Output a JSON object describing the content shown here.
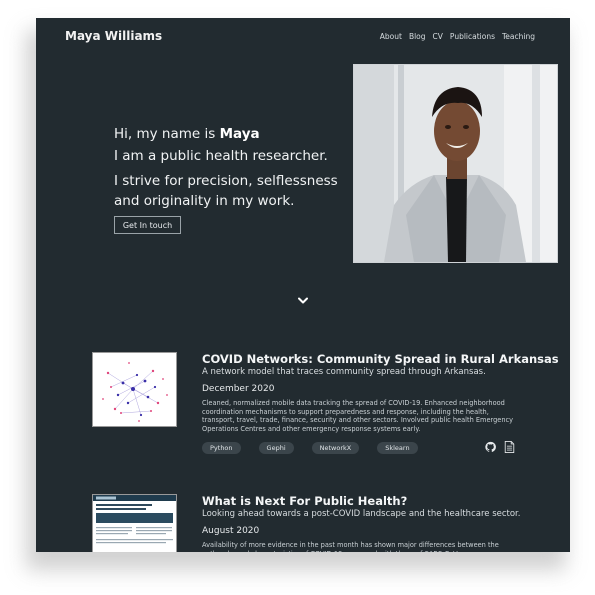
{
  "header": {
    "brand": "Maya Williams",
    "nav": [
      "About",
      "Blog",
      "CV",
      "Publications",
      "Teaching"
    ]
  },
  "hero": {
    "greeting": "Hi, my name is ",
    "name": "Maya",
    "line2": "I am a public health researcher.",
    "line3": "I strive for precision, selflessness and originality in my work.",
    "cta": "Get In touch"
  },
  "icons": {
    "scroll": "chevron-down-icon",
    "code": "github-icon",
    "doc": "document-icon"
  },
  "colors": {
    "background": "#222b30",
    "tag_bg": "#3b454b",
    "accent_text": "#f4f6f7"
  },
  "projects": [
    {
      "title": "COVID Networks: Community Spread in Rural Arkansas",
      "subtitle": "A network model that traces community spread through Arkansas.",
      "date": "December 2020",
      "description": "Cleaned, normalized mobile data tracking the spread of COVID-19. Enhanced neighborhood coordination mechanisms to support preparedness and response, including the health, transport, travel, trade, finance, security and other sectors. Involved public health Emergency Operations Centres and other emergency response systems early.",
      "tags": [
        "Python",
        "Gephi",
        "NetworkX",
        "Sklearn"
      ]
    },
    {
      "title": "What is Next For Public Health?",
      "subtitle": "Looking ahead towards a post-COVID landscape and the healthcare sector.",
      "date": "August 2020",
      "description": "Availability of more evidence in the past month has shown major differences between the outbreaks and characteristics of COVID-19 compared with those of SARS-CoV."
    }
  ]
}
